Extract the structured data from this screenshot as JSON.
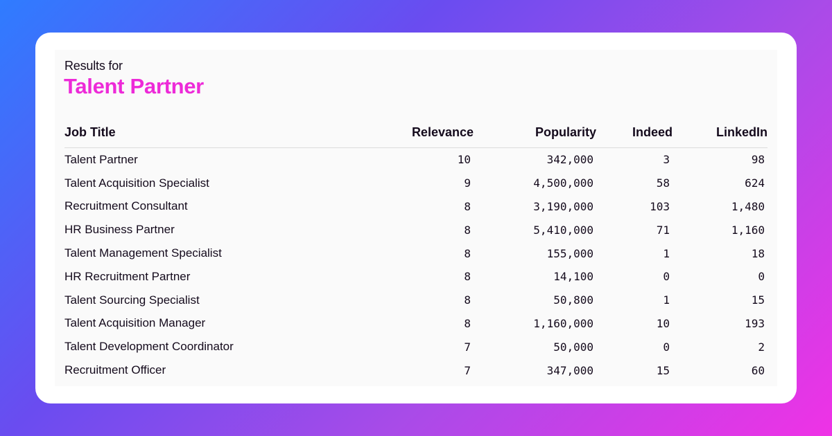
{
  "header": {
    "subtitle": "Results for",
    "query": "Talent Partner"
  },
  "table": {
    "columns": [
      "Job Title",
      "Relevance",
      "Popularity",
      "Indeed",
      "LinkedIn"
    ],
    "rows": [
      [
        "Talent Partner",
        "10",
        "342,000",
        "3",
        "98"
      ],
      [
        "Talent Acquisition Specialist",
        "9",
        "4,500,000",
        "58",
        "624"
      ],
      [
        "Recruitment Consultant",
        "8",
        "3,190,000",
        "103",
        "1,480"
      ],
      [
        "HR Business Partner",
        "8",
        "5,410,000",
        "71",
        "1,160"
      ],
      [
        "Talent Management Specialist",
        "8",
        "155,000",
        "1",
        "18"
      ],
      [
        "HR Recruitment Partner",
        "8",
        "14,100",
        "0",
        "0"
      ],
      [
        "Talent Sourcing Specialist",
        "8",
        "50,800",
        "1",
        "15"
      ],
      [
        "Talent Acquisition Manager",
        "8",
        "1,160,000",
        "10",
        "193"
      ],
      [
        "Talent Development Coordinator",
        "7",
        "50,000",
        "0",
        "2"
      ],
      [
        "Recruitment Officer",
        "7",
        "347,000",
        "15",
        "60"
      ]
    ]
  },
  "colors": {
    "accent": "#ed2ad8",
    "text": "#140a1c",
    "gradient_start": "#2f7cff",
    "gradient_end": "#ef32e6"
  }
}
